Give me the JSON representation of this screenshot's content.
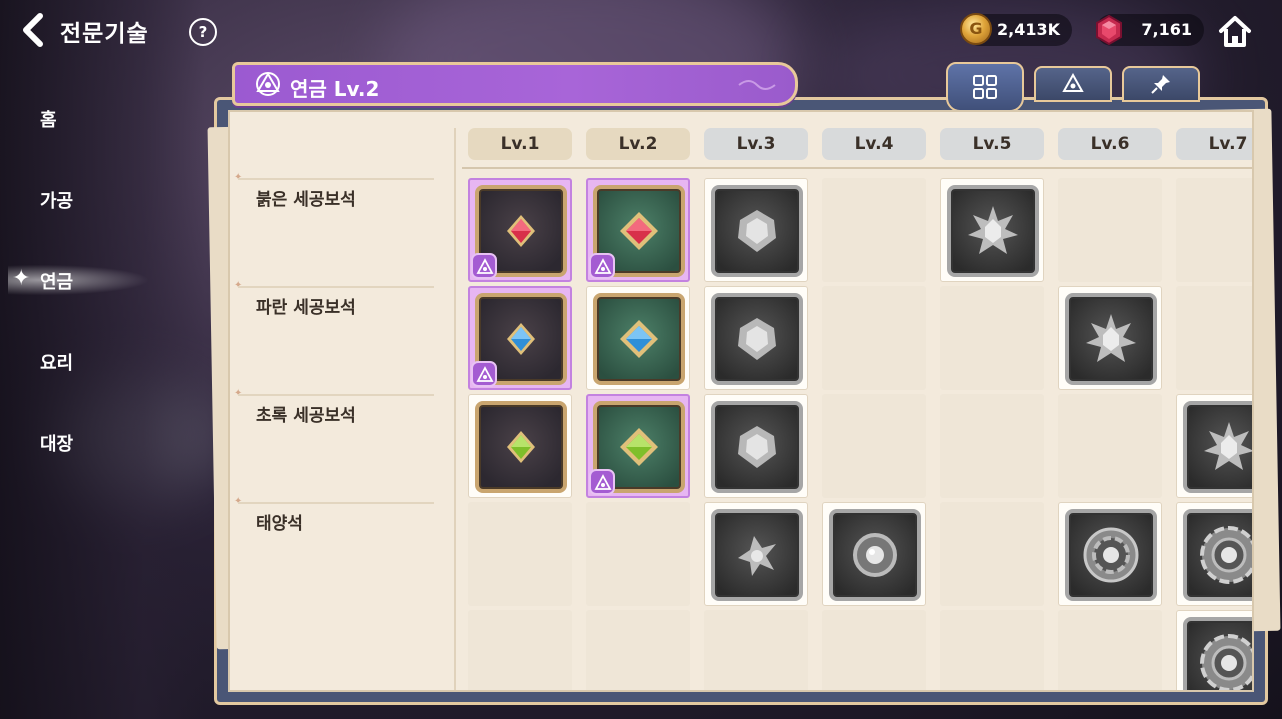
{
  "header": {
    "title": "전문기술",
    "help_glyph": "?",
    "gold_amount": "2,413K",
    "gem_amount": "7,161"
  },
  "sidebar": {
    "items": [
      {
        "label": "홈"
      },
      {
        "label": "가공"
      },
      {
        "label": "연금",
        "active": true
      },
      {
        "label": "요리"
      },
      {
        "label": "대장"
      }
    ]
  },
  "panel": {
    "title": "연금 Lv.2",
    "tabs": [
      {
        "icon": "grid-icon",
        "active": true
      },
      {
        "icon": "alchemy-icon",
        "active": false
      },
      {
        "icon": "pin-icon",
        "active": false
      }
    ]
  },
  "levels": [
    "Lv.1",
    "Lv.2",
    "Lv.3",
    "Lv.4",
    "Lv.5",
    "Lv.6",
    "Lv.7"
  ],
  "rows": [
    {
      "label": "붉은 세공보석"
    },
    {
      "label": "파란 세공보석"
    },
    {
      "label": "초록 세공보석"
    },
    {
      "label": "태양석"
    },
    {
      "label": ""
    }
  ],
  "colors": {
    "ribbon": "#a865d8",
    "owned_cell": "#e7b6f2",
    "red_gem": "#d8304a",
    "blue_gem": "#2f8fd8",
    "green_gem": "#7fbf2a"
  }
}
